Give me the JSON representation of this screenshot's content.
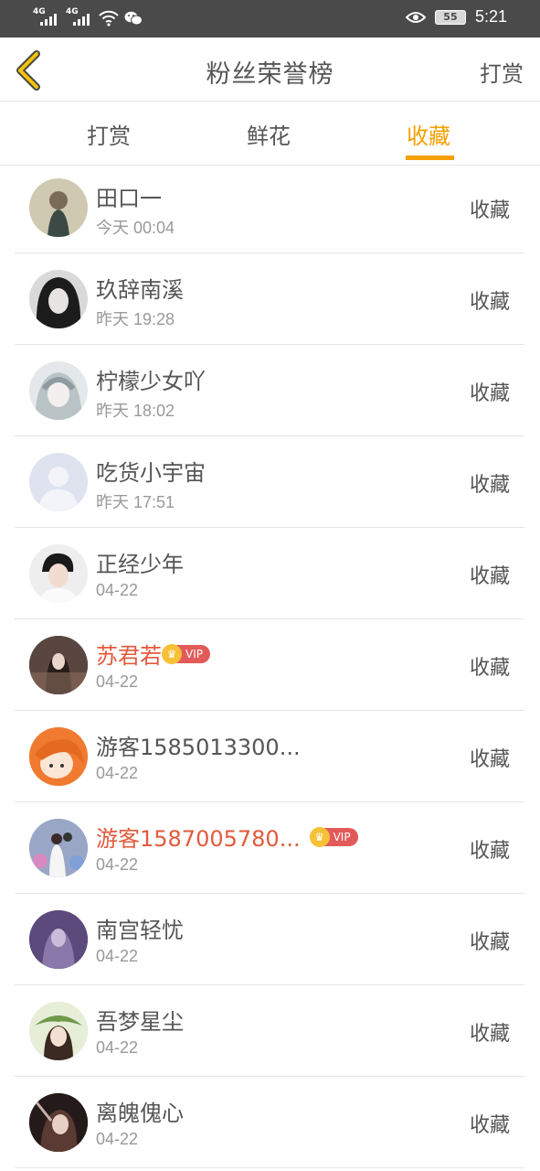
{
  "status_bar": {
    "network1": "4G",
    "network2": "4G",
    "battery": "55",
    "time": "5:21"
  },
  "header": {
    "title": "粉丝荣誉榜",
    "action": "打赏"
  },
  "tabs": [
    {
      "label": "打赏",
      "active": false
    },
    {
      "label": "鲜花",
      "active": false
    },
    {
      "label": "收藏",
      "active": true
    }
  ],
  "accent_color": "#f5a000",
  "vip_color": "#e25a3c",
  "list": [
    {
      "name": "田口一",
      "time": "今天 00:04",
      "action": "收藏",
      "vip": false
    },
    {
      "name": "玖辞南溪",
      "time": "昨天 19:28",
      "action": "收藏",
      "vip": false
    },
    {
      "name": "柠檬少女吖",
      "time": "昨天 18:02",
      "action": "收藏",
      "vip": false
    },
    {
      "name": "吃货小宇宙",
      "time": "昨天 17:51",
      "action": "收藏",
      "vip": false
    },
    {
      "name": "正经少年",
      "time": "04-22",
      "action": "收藏",
      "vip": false
    },
    {
      "name": "苏君若",
      "time": "04-22",
      "action": "收藏",
      "vip": true,
      "vip_label": "VIP"
    },
    {
      "name": "游客1585013300...",
      "time": "04-22",
      "action": "收藏",
      "vip": false
    },
    {
      "name": "游客1587005780...",
      "time": "04-22",
      "action": "收藏",
      "vip": true,
      "vip_label": "VIP"
    },
    {
      "name": "南宫轻忧",
      "time": "04-22",
      "action": "收藏",
      "vip": false
    },
    {
      "name": "吾梦星尘",
      "time": "04-22",
      "action": "收藏",
      "vip": false
    },
    {
      "name": "离魄傀心",
      "time": "04-22",
      "action": "收藏",
      "vip": false
    }
  ]
}
